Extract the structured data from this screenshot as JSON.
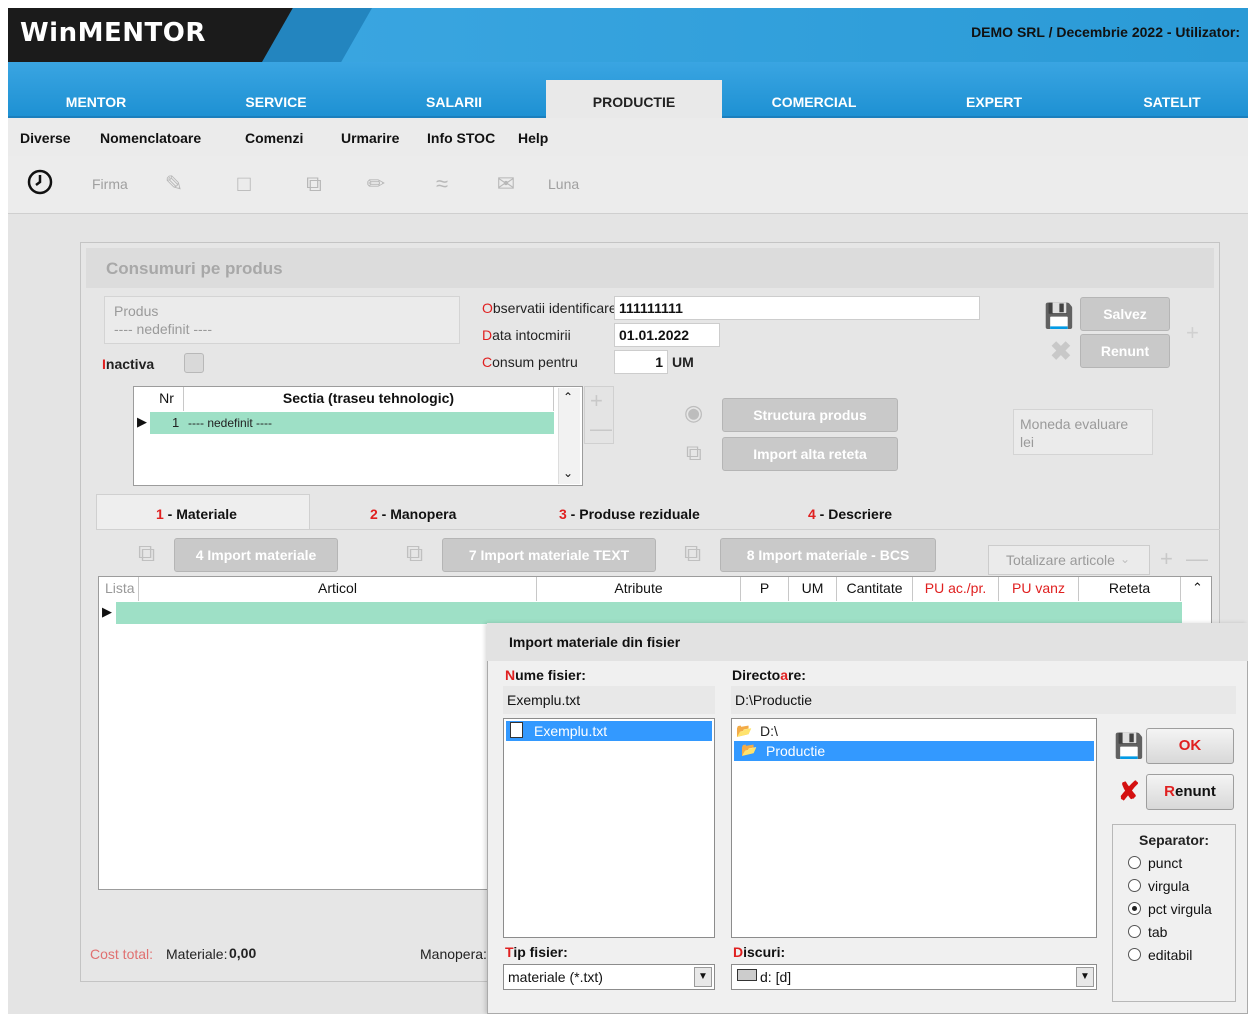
{
  "app": {
    "logo": "WinMENTOR",
    "company": "DEMO SRL / Decembrie 2022 - Utilizator:"
  },
  "main_tabs": [
    "MENTOR",
    "SERVICE",
    "SALARII",
    "PRODUCTIE",
    "COMERCIAL",
    "EXPERT",
    "SATELIT"
  ],
  "menu": [
    "Diverse",
    "Nomenclatoare",
    "Comenzi",
    "Urmarire",
    "Info STOC",
    "Help"
  ],
  "toolbar": {
    "firma": "Firma",
    "luna": "Luna"
  },
  "form": {
    "title": "Consumuri pe produs",
    "produs_label": "Produs",
    "produs_value": "---- nedefinit ----",
    "inactiva_first": "I",
    "inactiva_rest": "nactiva",
    "obs_first": "O",
    "obs_rest": "bservatii identificare",
    "obs_value": "111111111",
    "data_first": "D",
    "data_rest": "ata intocmirii",
    "data_value": "01.01.2022",
    "consum_first": "C",
    "consum_rest": "onsum pentru",
    "consum_value": "1",
    "consum_unit": "UM",
    "salvez": "Salvez",
    "renunt": "Renunt",
    "structura": "Structura produs",
    "import_reteta": "Import alta reteta",
    "moneda_label": "Moneda evaluare",
    "moneda_value": "lei",
    "sectii_headers": [
      "Nr",
      "Sectia (traseu tehnologic)"
    ],
    "sectii_rows": [
      {
        "nr": "1",
        "sectia": "---- nedefinit ----"
      }
    ],
    "tabs": [
      {
        "num": "1",
        "label": " - Materiale"
      },
      {
        "num": "2",
        "label": " - Manopera"
      },
      {
        "num": "3",
        "label": " - Produse reziduale"
      },
      {
        "num": "4",
        "label": " - Descriere"
      }
    ],
    "import_buttons": [
      "4 Import materiale",
      "7 Import materiale TEXT",
      "8 Import materiale - BCS"
    ],
    "totalizare": "Totalizare articole",
    "materiale_headers": [
      "Lista",
      "Articol",
      "Atribute",
      "P",
      "UM",
      "Cantitate",
      "PU ac./pr.",
      "PU vanz",
      "Reteta"
    ],
    "cost_total": "Cost total:",
    "materiale_label": "Materiale:",
    "materiale_value": "0,00",
    "manopera_label": "Manopera:"
  },
  "dialog": {
    "title": "Import materiale din fisier",
    "nume_first": "N",
    "nume_rest": "ume fisier:",
    "nume_value": "Exemplu.txt",
    "files": [
      "Exemplu.txt"
    ],
    "dir_pre": "Directo",
    "dir_hl": "a",
    "dir_post": "re:",
    "dir_value": "D:\\Productie",
    "dirs": [
      "D:\\",
      "Productie"
    ],
    "tip_first": "T",
    "tip_rest": "ip fisier:",
    "tip_value": "materiale (*.txt)",
    "disc_first": "D",
    "disc_rest": "iscuri:",
    "disc_value": "d: [d]",
    "ok": "OK",
    "renunt_first": "R",
    "renunt_rest": "enunt",
    "separator_title": "Separator:",
    "separators": [
      "punct",
      "virgula",
      "pct virgula",
      "tab",
      "editabil"
    ],
    "separator_selected": "pct virgula"
  }
}
